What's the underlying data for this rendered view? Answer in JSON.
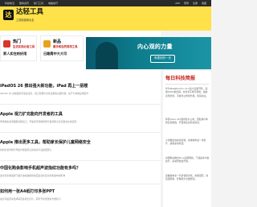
{
  "topbar": {
    "links": [
      "科技前沿",
      "数码资讯",
      "热门工具",
      "电脑技巧"
    ],
    "right": [
      "APP",
      "登录",
      "注册",
      "收藏"
    ]
  },
  "header": {
    "logo_char": "达",
    "title": "达轻工具",
    "subtitle": "工具精选网大全"
  },
  "cards": {
    "hot": {
      "title": "热门",
      "desc": "生活实用必备工具",
      "sub": "家人实在的好用"
    },
    "new": {
      "title": "新品",
      "desc": "最多和自然常用工具",
      "sub": "日期周中大大可"
    }
  },
  "banner": {
    "title": "内心观的力量",
    "button": "有更好的一天"
  },
  "articles": [
    {
      "title": "iPadOS 26 推出强大新功能，iPad 再上一层楼",
      "meta": "iPadOS 26 系统更新带来多任务、窗口管理与文件应用等全面升级，生产力体验显著提升"
    },
    {
      "title": "Apple 视力扩充能向开发者的工具",
      "meta": "苹果发布多项辅助功能接口，开发者可调用视觉与语音能力打造更友好的应用"
    },
    {
      "title": "Apple 推出更多工具，帮助家长保护儿童网络安全",
      "meta": "新的家长控制与年龄分级选项让家庭共享设备更安心"
    },
    {
      "title": "中国化购会影响手机超声波指纹功能有多吗？",
      "meta": "多位专家解读屏下超声波指纹模组供应链变化及对新机发布的影响"
    },
    {
      "title": "如何用一张A4纸打印多张PPT",
      "meta": "在打印设置中选择每页多张幻灯片，即可节省纸张并方便复习"
    }
  ],
  "sidebar": {
    "title": "每日科技简报",
    "tips": [
      "华为MatePad Pro 13.2英寸近期开售，采用OLED柔性屏，支持手写笔与键盘，续航表现优秀，平板办公体验升级，值得关注。",
      "苹果Vision Pro国内售价公布，首批用户体验反馈积极，开发者生态持续完善。",
      "小米推出快充新标准，充电效率进一步提升，兼容多款机型。",
      "中国移动推出5G-A商用网络，下载速率大幅提升，多城市陆续开通。",
      "荣耀发布新一代折叠屏手机，重量更轻，铰链更耐用，影像能力全面增强。"
    ]
  },
  "colors": {
    "brand_yellow": "#ffe14a",
    "accent_red": "#c8261d",
    "hot_icon": "#d9342b",
    "new_icon": "#e8a21b",
    "banner_teal": "#0d7c8c"
  }
}
